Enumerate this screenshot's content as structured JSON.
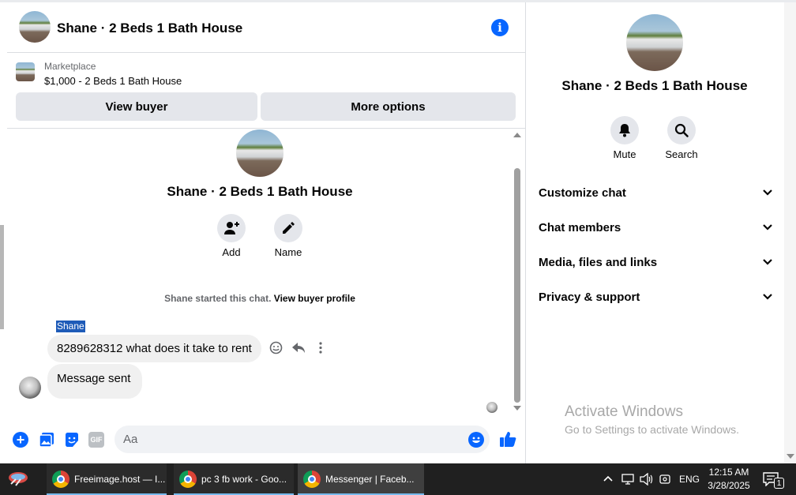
{
  "header": {
    "title": "Shane · 2 Beds 1 Bath House"
  },
  "marketplace": {
    "label": "Marketplace",
    "listing": "$1,000 - 2 Beds 1 Bath House",
    "view_buyer": "View buyer",
    "more_options": "More options"
  },
  "chat": {
    "title": "Shane · 2 Beds 1 Bath House",
    "add_label": "Add",
    "name_label": "Name",
    "started_text": "Shane started this chat.",
    "view_profile": "View buyer profile",
    "sender": "Shane",
    "messages": [
      {
        "text": "8289628312 what does it take to rent"
      },
      {
        "text": "Message sent"
      }
    ],
    "composer_placeholder": "Aa"
  },
  "sidebar": {
    "title": "Shane · 2 Beds 1 Bath House",
    "mute_label": "Mute",
    "search_label": "Search",
    "sections": [
      {
        "label": "Customize chat"
      },
      {
        "label": "Chat members"
      },
      {
        "label": "Media, files and links"
      },
      {
        "label": "Privacy & support"
      }
    ]
  },
  "watermark": {
    "title": "Activate Windows",
    "subtitle": "Go to Settings to activate Windows."
  },
  "taskbar": {
    "apps": [
      {
        "label": "Freeimage.host — I..."
      },
      {
        "label": "pc 3 fb work - Goo..."
      },
      {
        "label": "Messenger | Faceb..."
      }
    ],
    "lang": "ENG",
    "time": "12:15 AM",
    "date": "3/28/2025",
    "notif_count": "1"
  },
  "colors": {
    "accent": "#0866ff",
    "taskbar_bg": "#202020"
  },
  "icons": [
    "info-icon",
    "person-add-icon",
    "pencil-icon",
    "bell-icon",
    "search-icon",
    "chevron-down-icon",
    "plus-icon",
    "image-icon",
    "sticker-icon",
    "gif-icon",
    "emoji-icon",
    "thumbs-up-icon",
    "reply-icon",
    "more-icon"
  ]
}
